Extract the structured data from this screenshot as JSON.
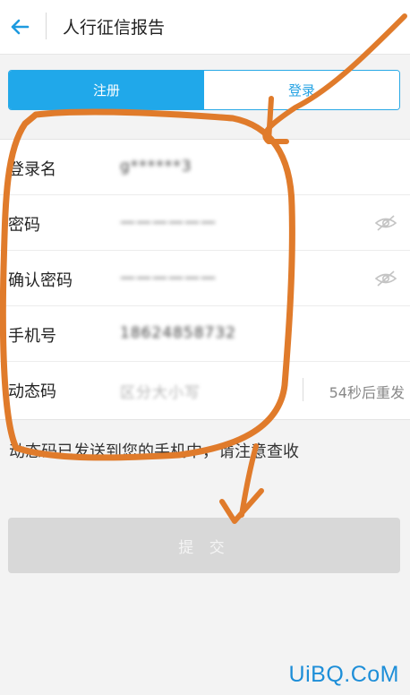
{
  "header": {
    "title": "人行征信报告",
    "back_icon": "arrow-left-icon"
  },
  "tabs": [
    {
      "label": "注册",
      "active": true
    },
    {
      "label": "登录",
      "active": false
    }
  ],
  "form": {
    "username": {
      "label": "登录名",
      "value": "g******3"
    },
    "password": {
      "label": "密码",
      "value": "——————"
    },
    "confirm_password": {
      "label": "确认密码",
      "value": "——————"
    },
    "phone": {
      "label": "手机号",
      "value": "18624858732"
    },
    "dynamic_code": {
      "label": "动态码",
      "placeholder": "区分大小写",
      "resend_label": "54秒后重发"
    }
  },
  "notice": "动态码已发送到您的手机中，请注意查收",
  "submit_label": "提 交",
  "watermark": "UiBQ.CoM",
  "colors": {
    "accent": "#20a8ea",
    "annotation": "#e07b2b",
    "disabled_button": "#d8d8d8",
    "watermark": "#1d8ed8"
  }
}
